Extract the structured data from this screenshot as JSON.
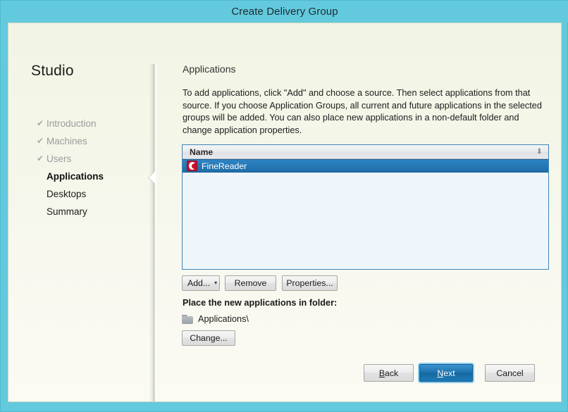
{
  "window": {
    "title": "Create Delivery Group",
    "titlebar_color": "#63c9dd",
    "body_color": "#f6f7ea"
  },
  "sidebar": {
    "product_title": "Studio",
    "check_glyph": "✔",
    "items": [
      {
        "label": "Introduction",
        "state": "done"
      },
      {
        "label": "Machines",
        "state": "done"
      },
      {
        "label": "Users",
        "state": "done"
      },
      {
        "label": "Applications",
        "state": "current"
      },
      {
        "label": "Desktops",
        "state": "pending"
      },
      {
        "label": "Summary",
        "state": "pending"
      }
    ]
  },
  "main": {
    "heading": "Applications",
    "description": "To add applications, click \"Add\" and choose a source. Then select applications from that source. If you choose Application Groups, all current and future applications in the selected groups will be added. You can also place new applications in a non-default folder and change application properties.",
    "list": {
      "column_header": "Name",
      "sort_indicator": "⬇",
      "selected_color": "#1e6ea8",
      "rows": [
        {
          "name": "FineReader",
          "icon": "abbyy-finereader-icon",
          "icon_color": "#c8102e",
          "selected": true
        }
      ]
    },
    "list_buttons": {
      "add_label": "Add...",
      "add_caret": "▾",
      "remove_label": "Remove",
      "properties_label": "Properties..."
    },
    "folder_section": {
      "label": "Place the new applications in folder:",
      "folder_icon": "folder-icon",
      "folder_path": "Applications\\",
      "change_label": "Change..."
    }
  },
  "footer": {
    "back_label": "Back",
    "back_accel": "B",
    "next_label": "Next",
    "next_accel": "N",
    "cancel_label": "Cancel",
    "primary_color": "#1b72ad"
  }
}
